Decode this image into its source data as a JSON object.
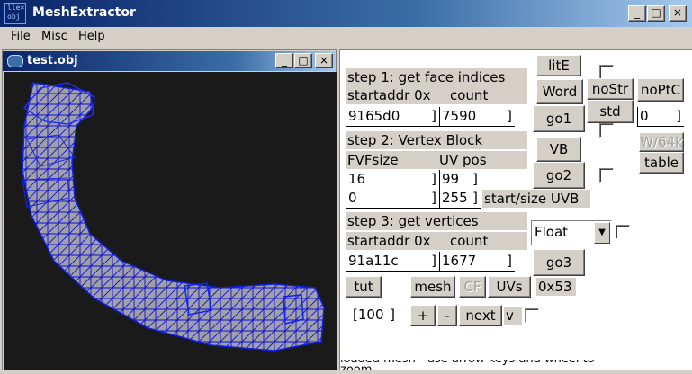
{
  "app": {
    "title": "MeshExtractor",
    "icon_text": "lle×\nobj"
  },
  "window_controls": {
    "minimize": "_",
    "maximize": "□",
    "close": "×"
  },
  "menu": {
    "items": [
      "File",
      "Misc",
      "Help"
    ]
  },
  "child_window": {
    "title": "test.obj"
  },
  "step1": {
    "title": "step 1: get face indices",
    "startaddr_label": "startaddr 0x",
    "count_label": "count",
    "startaddr_value": "9165d0",
    "count_value": "7590"
  },
  "step2": {
    "title": "step 2: Vertex Block",
    "fvfsize_label": "FVFsize",
    "uvpos_label": "UV pos",
    "fvfsize_value": "16",
    "uvpos_value": "99",
    "start_value": "0",
    "size_value": "255",
    "startsize_label": "start/size UVB"
  },
  "step3": {
    "title": "step 3: get vertices",
    "startaddr_label": "startaddr 0x",
    "count_label": "count",
    "startaddr_value": "91a11c",
    "count_value": "1677",
    "format_value": "Float"
  },
  "buttons": {
    "lite": "litE",
    "word": "Word",
    "go1": "go1",
    "nostr": "noStr",
    "std": "std",
    "noptc": "noPtC",
    "w64k": "W/64k",
    "table": "table",
    "vb": "VB",
    "go2": "go2",
    "go3": "go3",
    "tut": "tut",
    "mesh": "mesh",
    "cf": "CF",
    "uvs": "UVs",
    "plus": "+",
    "minus": "-",
    "next": "next"
  },
  "side_field_value": "0",
  "hex_readout": "0x53",
  "step_value": "100",
  "v_label": "v",
  "status_text": "loaded mesh - use arrow keys and wheel to zoom"
}
